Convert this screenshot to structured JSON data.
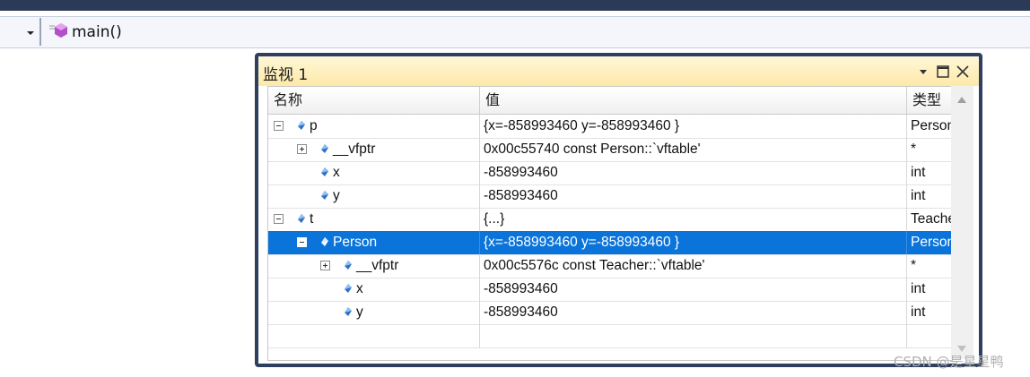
{
  "toolbar": {
    "member": "main()"
  },
  "watch": {
    "title": "监视 1",
    "columns": [
      "名称",
      "值",
      "类型"
    ],
    "rows": [
      {
        "name": "p",
        "value": "{x=-858993460 y=-858993460 }",
        "type": "Person",
        "level": 0,
        "toggle": "minus",
        "selected": false
      },
      {
        "name": "__vfptr",
        "value": "0x00c55740 const Person::`vftable'",
        "type": "*",
        "level": 1,
        "toggle": "plus",
        "selected": false
      },
      {
        "name": "x",
        "value": "-858993460",
        "type": "int",
        "level": 1,
        "toggle": "",
        "selected": false
      },
      {
        "name": "y",
        "value": "-858993460",
        "type": "int",
        "level": 1,
        "toggle": "",
        "selected": false
      },
      {
        "name": "t",
        "value": "{...}",
        "type": "Teacher",
        "level": 0,
        "toggle": "minus",
        "selected": false
      },
      {
        "name": "Person",
        "value": "{x=-858993460 y=-858993460 }",
        "type": "Person",
        "level": 1,
        "toggle": "minus",
        "selected": true
      },
      {
        "name": "__vfptr",
        "value": "0x00c5576c const Teacher::`vftable'",
        "type": "*",
        "level": 2,
        "toggle": "plus",
        "selected": false
      },
      {
        "name": "x",
        "value": "-858993460",
        "type": "int",
        "level": 2,
        "toggle": "",
        "selected": false
      },
      {
        "name": "y",
        "value": "-858993460",
        "type": "int",
        "level": 2,
        "toggle": "",
        "selected": false
      },
      {
        "name": "",
        "value": "",
        "type": "",
        "level": 0,
        "toggle": "",
        "selected": false
      }
    ]
  },
  "watermark": "CSDN @是星星鸭",
  "colors": {
    "selection": "#0a74da",
    "titlebar": "#fde9a8",
    "frame": "#2e3f60"
  }
}
